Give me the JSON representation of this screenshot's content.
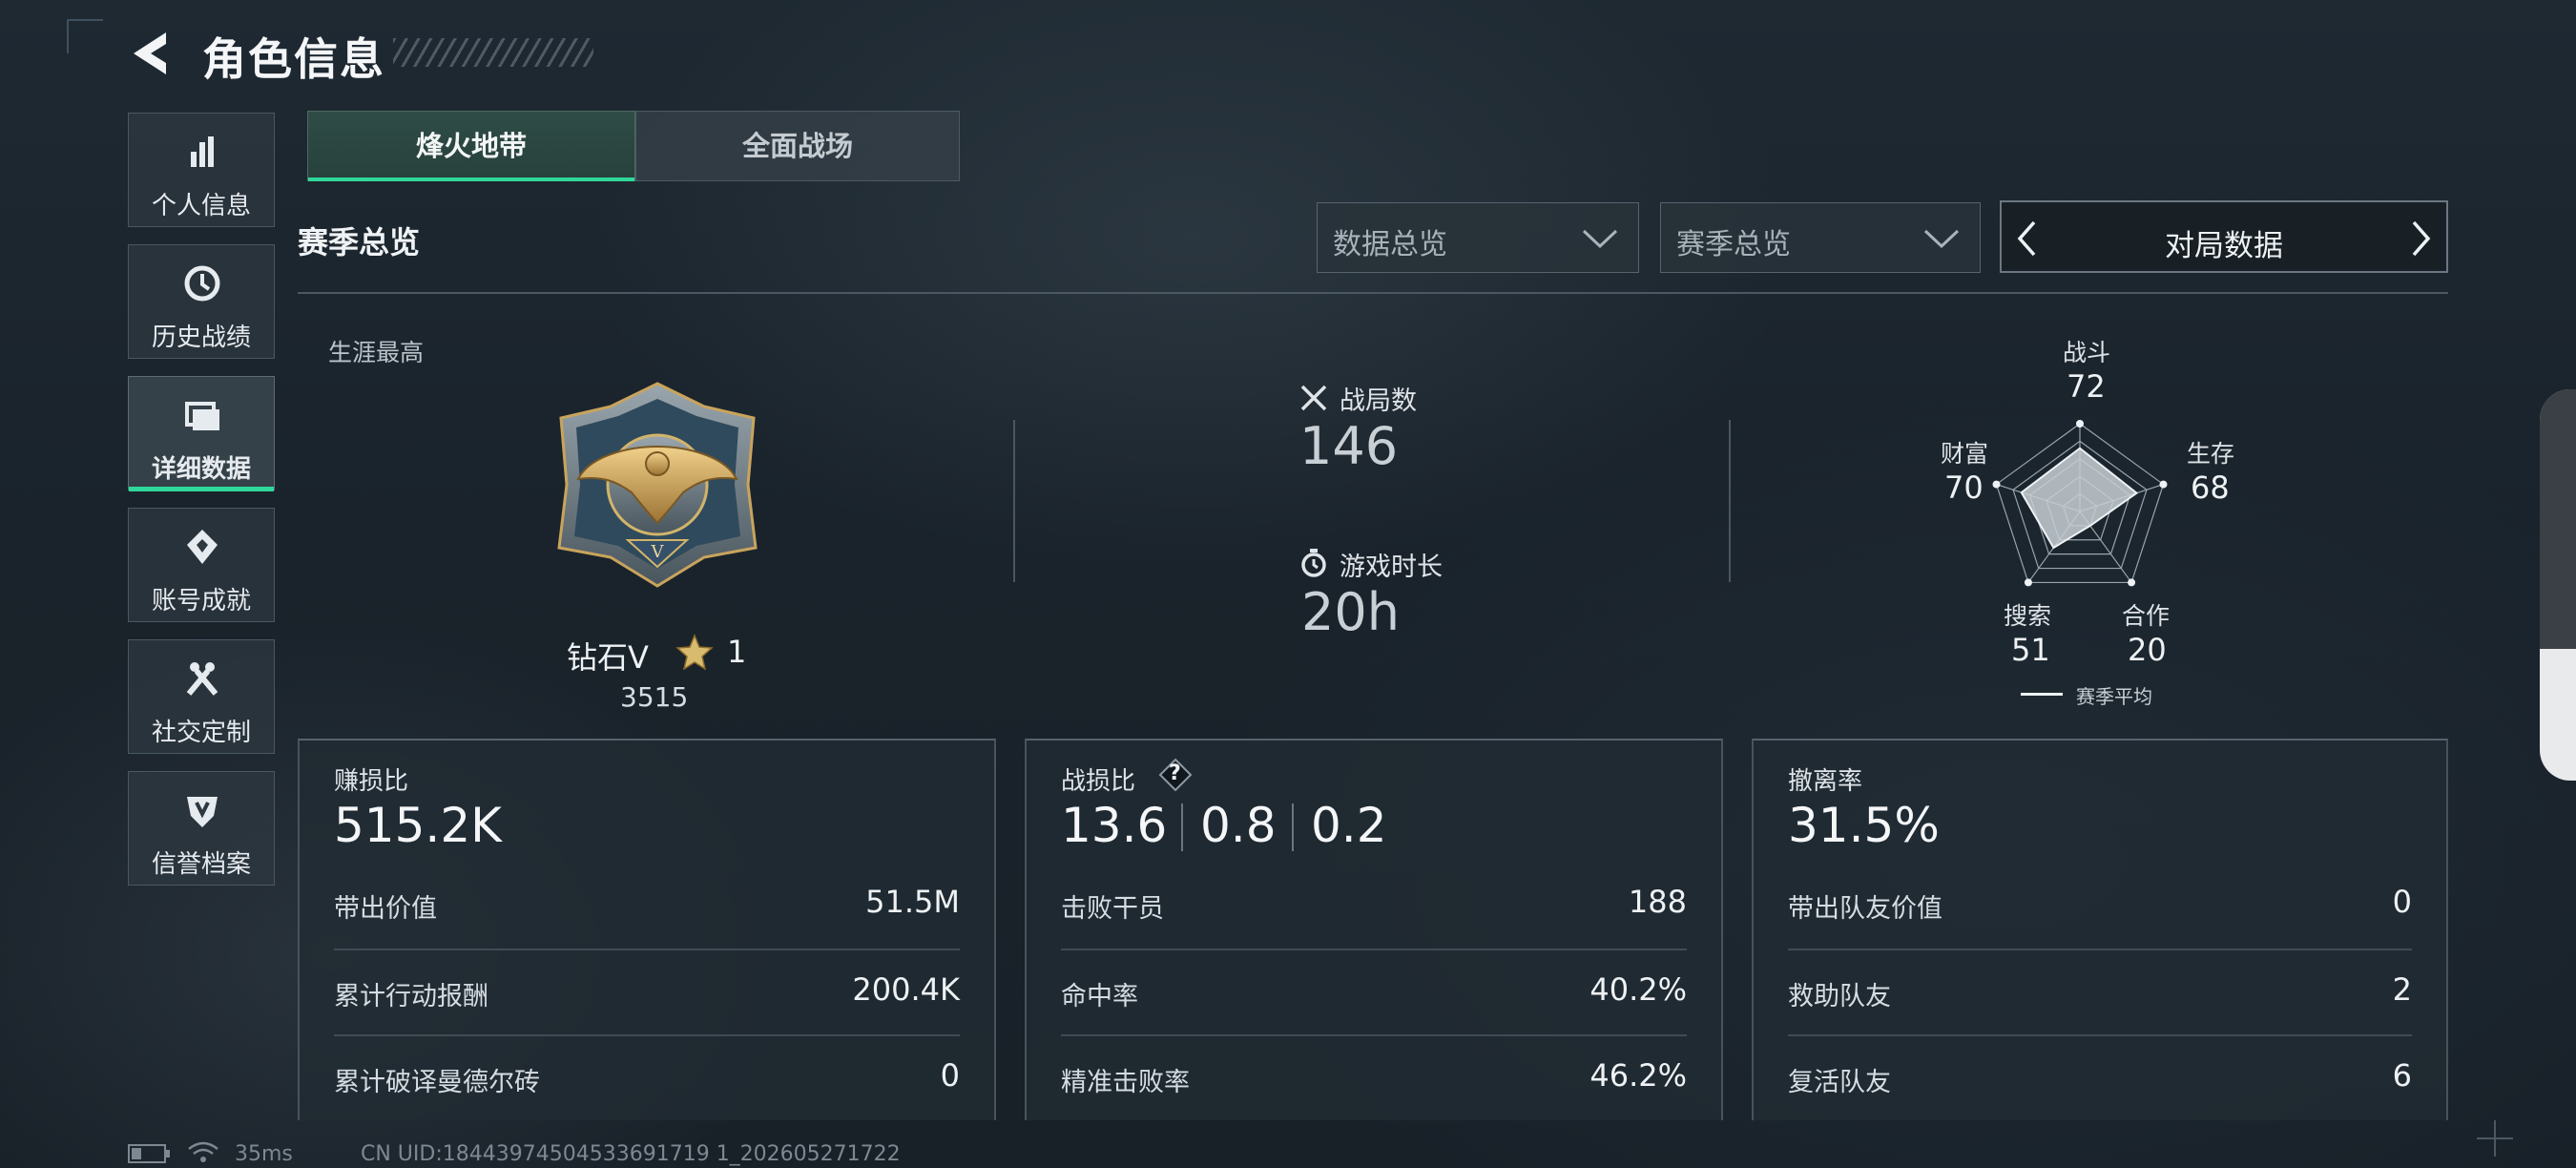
{
  "header": {
    "title": "角色信息"
  },
  "sidebar": {
    "items": [
      {
        "label": "个人信息",
        "icon": "bar-chart-icon"
      },
      {
        "label": "历史战绩",
        "icon": "clock-icon"
      },
      {
        "label": "详细数据",
        "icon": "folder-icon",
        "active": true
      },
      {
        "label": "账号成就",
        "icon": "achievement-icon"
      },
      {
        "label": "社交定制",
        "icon": "tools-icon"
      },
      {
        "label": "信誉档案",
        "icon": "shield-badge-icon"
      }
    ]
  },
  "tabs": [
    {
      "label": "烽火地带",
      "active": true
    },
    {
      "label": "全面战场",
      "active": false
    }
  ],
  "section": {
    "title": "赛季总览"
  },
  "filters": {
    "dropdown1": "数据总览",
    "dropdown2": "赛季总览",
    "pager_label": "对局数据"
  },
  "career": {
    "label": "生涯最高",
    "rank_name": "钻石V",
    "stars": "1",
    "score": "3515"
  },
  "summary": {
    "matches_label": "战局数",
    "matches_value": "146",
    "playtime_label": "游戏时长",
    "playtime_value": "20h"
  },
  "radar": {
    "axes": [
      {
        "label": "战斗",
        "value": 72
      },
      {
        "label": "生存",
        "value": 68
      },
      {
        "label": "合作",
        "value": 20
      },
      {
        "label": "搜索",
        "value": 51
      },
      {
        "label": "财富",
        "value": 70
      }
    ],
    "values_text": [
      "72",
      "68",
      "20",
      "51",
      "70"
    ],
    "legend": "赛季平均",
    "fill_color": "#c8d0d6"
  },
  "cards": {
    "profit": {
      "title": "赚损比",
      "main": "515.2K",
      "rows": [
        {
          "label": "带出价值",
          "value": "51.5M"
        },
        {
          "label": "累计行动报酬",
          "value": "200.4K"
        },
        {
          "label": "累计破译曼德尔砖",
          "value": "0"
        }
      ]
    },
    "combat": {
      "title": "战损比",
      "help": "?",
      "main": [
        "13.6",
        "0.8",
        "0.2"
      ],
      "rows": [
        {
          "label": "击败干员",
          "value": "188"
        },
        {
          "label": "命中率",
          "value": "40.2%"
        },
        {
          "label": "精准击败率",
          "value": "46.2%"
        }
      ]
    },
    "extract": {
      "title": "撤离率",
      "main": "31.5%",
      "rows": [
        {
          "label": "带出队友价值",
          "value": "0"
        },
        {
          "label": "救助队友",
          "value": "2"
        },
        {
          "label": "复活队友",
          "value": "6"
        }
      ]
    }
  },
  "status_bar": {
    "ping": "35ms",
    "uid": "CN UID:18443974504533691719 1_202605271722"
  },
  "colors": {
    "accent": "#2fd89a",
    "background": "#1a232b"
  }
}
